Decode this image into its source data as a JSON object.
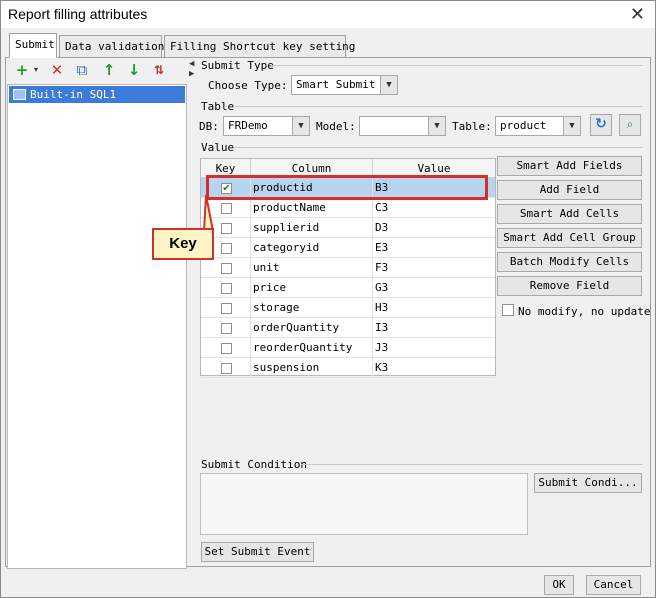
{
  "window": {
    "title": "Report filling attributes"
  },
  "tabs": [
    "Submit",
    "Data validation",
    "Filling Shortcut key setting"
  ],
  "tree": {
    "items": [
      "Built-in SQL1"
    ]
  },
  "submit_type": {
    "section_label": "Submit Type",
    "choose_label": "Choose Type:",
    "value": "Smart Submit"
  },
  "table_section": {
    "section_label": "Table",
    "db_label": "DB:",
    "db_value": "FRDemo",
    "model_label": "Model:",
    "model_value": "",
    "table_label": "Table:",
    "table_value": "product"
  },
  "value_section": {
    "section_label": "Value",
    "columns": [
      "Key",
      "Column",
      "Value"
    ],
    "rows": [
      {
        "key": true,
        "column": "productid",
        "value": "B3"
      },
      {
        "key": false,
        "column": "productName",
        "value": "C3"
      },
      {
        "key": false,
        "column": "supplierid",
        "value": "D3"
      },
      {
        "key": false,
        "column": "categoryid",
        "value": "E3"
      },
      {
        "key": false,
        "column": "unit",
        "value": "F3"
      },
      {
        "key": false,
        "column": "price",
        "value": "G3"
      },
      {
        "key": false,
        "column": "storage",
        "value": "H3"
      },
      {
        "key": false,
        "column": "orderQuantity",
        "value": "I3"
      },
      {
        "key": false,
        "column": "reorderQuantity",
        "value": "J3"
      },
      {
        "key": false,
        "column": "suspension",
        "value": "K3"
      }
    ],
    "buttons": [
      "Smart Add Fields",
      "Add Field",
      "Smart Add Cells",
      "Smart Add Cell Group",
      "Batch Modify Cells",
      "Remove Field"
    ],
    "no_modify_label": "No modify, no update"
  },
  "callout": {
    "text": "Key"
  },
  "submit_condition": {
    "section_label": "Submit Condition",
    "button": "Submit Condi..."
  },
  "set_submit_event": "Set Submit Event",
  "footer": {
    "ok": "OK",
    "cancel": "Cancel"
  },
  "colors": {
    "selection": "#3d7bd8",
    "highlight": "#d2302c",
    "callout_bg": "#fff4c6"
  }
}
